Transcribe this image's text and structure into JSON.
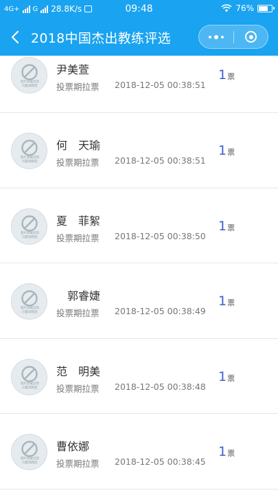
{
  "status_bar": {
    "network_1": "4G+",
    "network_2": "G",
    "speed": "28.8K/s",
    "time": "09:48",
    "battery_percent": "76%",
    "battery_level": 0.76
  },
  "nav": {
    "title": "2018中国杰出教练评选"
  },
  "colors": {
    "header_bg": "#1aa3f0",
    "vote_number": "#3a5fd3"
  },
  "rows": [
    {
      "name": "尹美萱",
      "source": "投票期拉票",
      "time": "2018-12-05 00:38:51",
      "votes": "1",
      "unit": "票"
    },
    {
      "name": "何　天瑜",
      "source": "投票期拉票",
      "time": "2018-12-05 00:38:51",
      "votes": "1",
      "unit": "票"
    },
    {
      "name": "夏　菲絮",
      "source": "投票期拉票",
      "time": "2018-12-05 00:38:50",
      "votes": "1",
      "unit": "票"
    },
    {
      "name": "　郭睿婕",
      "source": "投票期拉票",
      "time": "2018-12-05 00:38:49",
      "votes": "1",
      "unit": "票"
    },
    {
      "name": "范　明美",
      "source": "投票期拉票",
      "time": "2018-12-05 00:38:48",
      "votes": "1",
      "unit": "票"
    },
    {
      "name": "曹依娜",
      "source": "投票期拉票",
      "time": "2018-12-05 00:38:45",
      "votes": "1",
      "unit": "票"
    }
  ],
  "avatar_placeholder_text": [
    "图片加载出现",
    "问题请稍后"
  ]
}
